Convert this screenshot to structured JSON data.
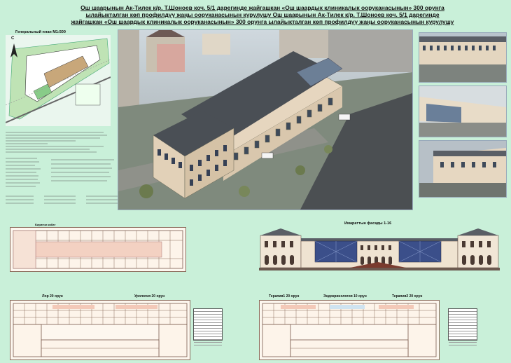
{
  "title": {
    "line1": "Ош шаарынын Ак-Тилек к/р. Т.Шоноев коч. 5/1 дарегинде жайгашкан «Ош шаардык клиникалык ооруканасынын» 300 орунга",
    "line2": "ылайыкталган көп профилдүү жаңы ооруканасынын курулушу Ош шаарынын Ак-Тилек к/р. Т.Шоноев коч. 5/1 дарегинде",
    "line3": "жайгашкан «Ош шаардык клиникалык ооруканасынын» 300 орунга ылайыкталган көп профилдүү жаңы ооруканасынын курулушу"
  },
  "site_plan": {
    "label": "Генеральный план М1:500",
    "compass": "С"
  },
  "facade": {
    "title": "Имараттын фасады 1-16"
  },
  "plans": {
    "ground_label": "Биринчи кабат",
    "lor": "Лор 20 орун",
    "urology": "Урология 20 орун",
    "therapy1": "Терапия1 20 орун",
    "endocrinology": "Эндокринология 10 орун",
    "therapy2": "Терапия2 20 орун"
  },
  "colors": {
    "background": "#c9f0d9",
    "wall": "#e9d8c4",
    "roof": "#4a4f55",
    "glass": "#3b4f8a"
  }
}
